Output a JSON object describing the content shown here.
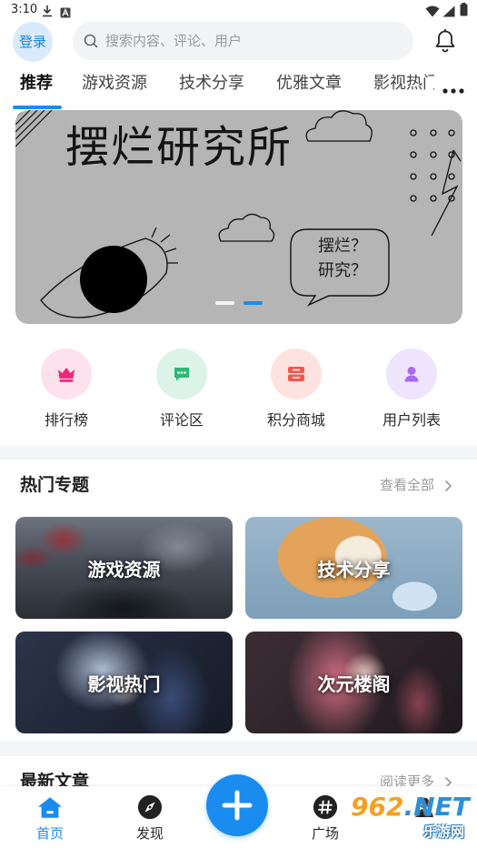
{
  "status_bar": {
    "time": "3:10",
    "left_icons": [
      "download-icon",
      "a-badge-icon"
    ],
    "right_icons": [
      "wifi-icon",
      "signal-icon",
      "battery-icon"
    ]
  },
  "header": {
    "login_label": "登录",
    "search_placeholder": "搜索内容、评论、用户",
    "search_icon": "search-icon",
    "notification_icon": "bell-icon"
  },
  "tabs": {
    "items": [
      {
        "label": "推荐",
        "active": true
      },
      {
        "label": "游戏资源",
        "active": false
      },
      {
        "label": "技术分享",
        "active": false
      },
      {
        "label": "优雅文章",
        "active": false
      },
      {
        "label": "影视热门",
        "active": false
      }
    ],
    "more_icon": "more-dots-icon"
  },
  "banner": {
    "title": "摆烂研究所",
    "bubble": [
      "摆烂？",
      "研究？"
    ],
    "slides": 2,
    "active_slide": 2
  },
  "quick_nav": [
    {
      "label": "排行榜",
      "icon": "crown-icon",
      "icon_color": "#f0287a",
      "bg_color": "#fde2ee"
    },
    {
      "label": "评论区",
      "icon": "chat-icon",
      "icon_color": "#2fb873",
      "bg_color": "#dcf3e7"
    },
    {
      "label": "积分商城",
      "icon": "store-icon",
      "icon_color": "#f0584e",
      "bg_color": "#fde3df"
    },
    {
      "label": "用户列表",
      "icon": "user-icon",
      "icon_color": "#a86af2",
      "bg_color": "#eee4fc"
    }
  ],
  "hot_topics": {
    "title": "热门专题",
    "more_label": "查看全部",
    "cards": [
      {
        "label": "游戏资源"
      },
      {
        "label": "技术分享"
      },
      {
        "label": "影视热门"
      },
      {
        "label": "次元楼阁"
      }
    ]
  },
  "latest_articles": {
    "title": "最新文章",
    "more_label": "阅读更多"
  },
  "bottom_nav": {
    "items": [
      {
        "label": "首页",
        "icon": "home-icon",
        "active": true
      },
      {
        "label": "发现",
        "icon": "compass-icon",
        "active": false
      },
      {
        "icon": "plus-icon",
        "active": false
      },
      {
        "label": "广场",
        "icon": "hash-icon",
        "active": false
      },
      {
        "icon": "user-icon",
        "active": false
      }
    ]
  },
  "watermark": {
    "number": "962",
    "suffix": ".NET",
    "name": "乐游网"
  },
  "colors": {
    "primary": "#1a8cf0",
    "login_bg": "#d9eafc",
    "search_bg": "#f2f3f5",
    "section_gap": "#f4f5f7",
    "banner_bg": "#b5b5b5",
    "muted_text": "#9a9a9a"
  }
}
